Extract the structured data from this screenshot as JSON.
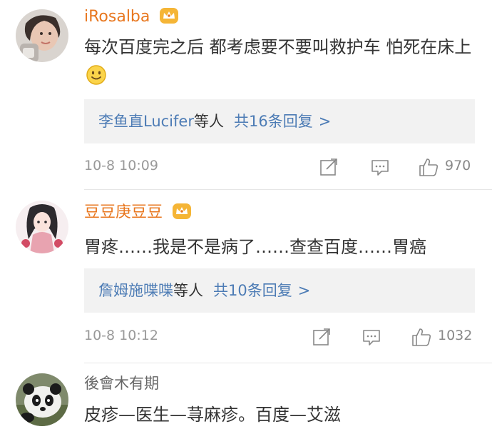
{
  "comments": [
    {
      "username": "iRosalba",
      "text": "每次百度完之后 都考虑要不要叫救护车 怕死在床上",
      "reply_names": "李鱼直Lucifer",
      "reply_others": "等人",
      "reply_count": "共16条回复",
      "reply_arrow": ">",
      "time": "10-8 10:09",
      "likes": "970"
    },
    {
      "username": "豆豆庚豆豆",
      "text": "胃疼……我是不是病了……查查百度……胃癌",
      "reply_names": "詹姆施喋喋",
      "reply_others": "等人",
      "reply_count": "共10条回复",
      "reply_arrow": ">",
      "time": "10-8 10:12",
      "likes": "1032"
    },
    {
      "username": "後會木有期",
      "text": "皮疹—医生—荨麻疹。百度—艾滋"
    }
  ],
  "colors": {
    "vip_name": "#e8771f",
    "link": "#4d7cb5",
    "reply_bg": "#f2f2f2",
    "meta": "#999999"
  },
  "icons": [
    "crown-badge-icon",
    "smiley-emoji-icon",
    "repost-icon",
    "comment-icon",
    "like-icon"
  ]
}
